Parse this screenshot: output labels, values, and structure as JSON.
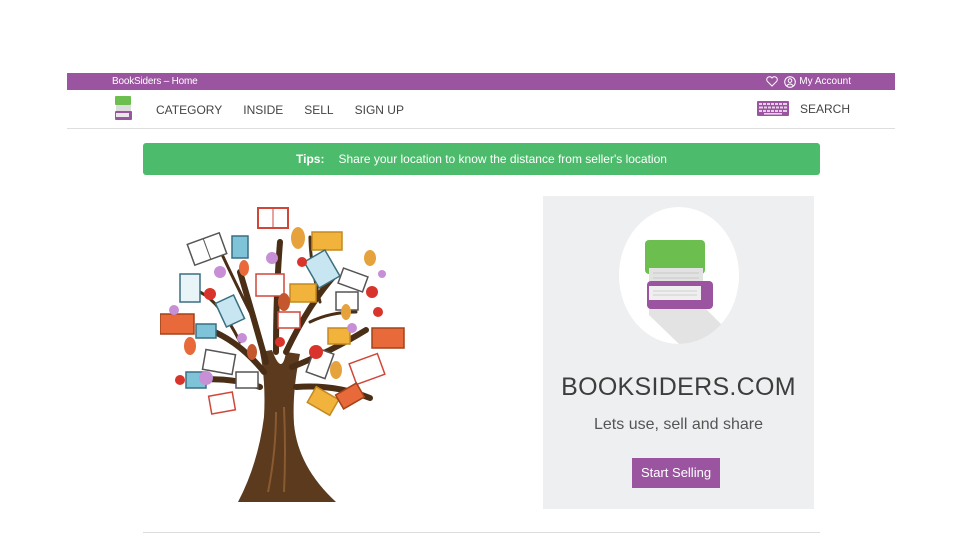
{
  "topbar": {
    "breadcrumb": "BookSiders – Home",
    "account_label": "My Account",
    "background": "#9b55a0"
  },
  "nav": {
    "items": [
      {
        "label": "CATEGORY"
      },
      {
        "label": "INSIDE"
      },
      {
        "label": "SELL"
      },
      {
        "label": "SIGN UP"
      }
    ],
    "search_label": "SEARCH",
    "icons": [
      "books-logo-icon",
      "keyboard-icon"
    ]
  },
  "tips": {
    "label": "Tips:",
    "text": "Share your location to know the distance from seller's location",
    "color": "#4cbb6c"
  },
  "promo": {
    "brand": "BOOKSIDERS.COM",
    "tagline": "Lets use, sell and share",
    "button_label": "Start Selling",
    "accent": "#9b55a0"
  }
}
